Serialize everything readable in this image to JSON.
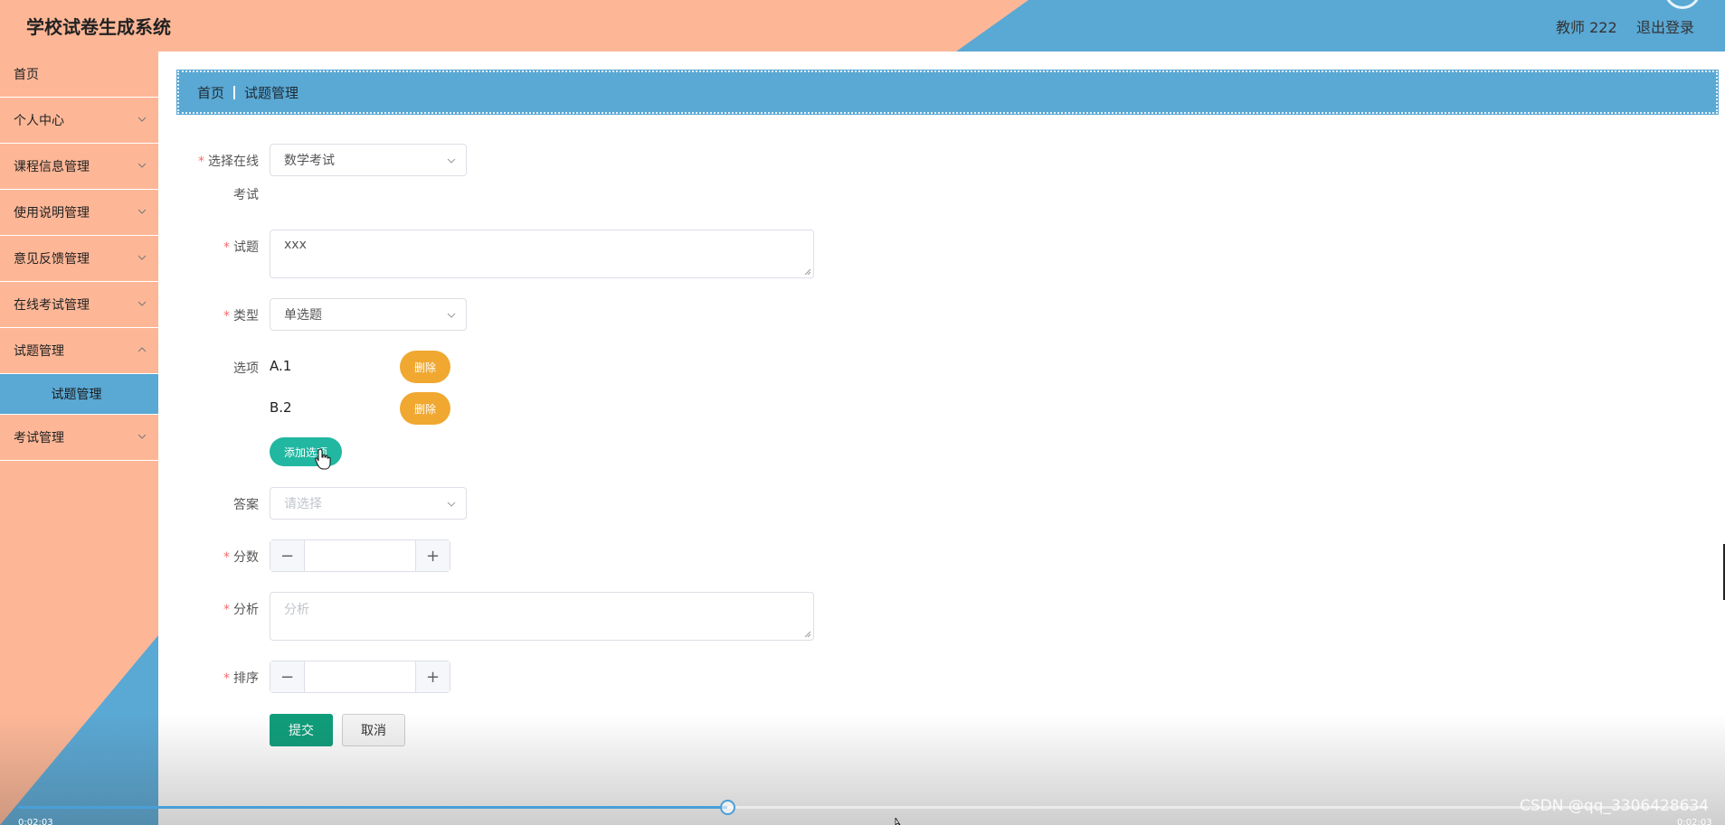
{
  "header": {
    "title": "学校试卷生成系统",
    "user": "教师 222",
    "logout": "退出登录",
    "colors": {
      "peach": "#fdb797",
      "blue": "#5aa8d4"
    }
  },
  "sidebar": {
    "items": [
      {
        "label": "首页"
      },
      {
        "label": "个人中心"
      },
      {
        "label": "课程信息管理"
      },
      {
        "label": "使用说明管理"
      },
      {
        "label": "意见反馈管理"
      },
      {
        "label": "在线考试管理"
      },
      {
        "label": "试题管理"
      },
      {
        "label": "考试管理"
      }
    ],
    "active_sub": "试题管理"
  },
  "breadcrumb": {
    "home": "首页",
    "current": "试题管理"
  },
  "form": {
    "exam": {
      "label_line1": "选择在线",
      "label_line2": "考试",
      "value": "数学考试"
    },
    "question": {
      "label": "试题",
      "value": "xxx"
    },
    "type": {
      "label": "类型",
      "value": "单选题"
    },
    "options": {
      "label": "选项",
      "items": [
        {
          "text": "A.1"
        },
        {
          "text": "B.2"
        }
      ],
      "delete_label": "删除",
      "add_label": "添加选项"
    },
    "answer": {
      "label": "答案",
      "placeholder": "请选择"
    },
    "score": {
      "label": "分数",
      "minus": "−",
      "plus": "+"
    },
    "analysis": {
      "label": "分析",
      "placeholder": "分析"
    },
    "sort": {
      "label": "排序",
      "minus": "−",
      "plus": "+"
    },
    "submit_label": "提交",
    "cancel_label": "取消"
  },
  "video": {
    "progress": 0.42,
    "time_left": "0:02:03",
    "time_right": "0:02:03",
    "watermark": "CSDN @qq_3306428634"
  }
}
